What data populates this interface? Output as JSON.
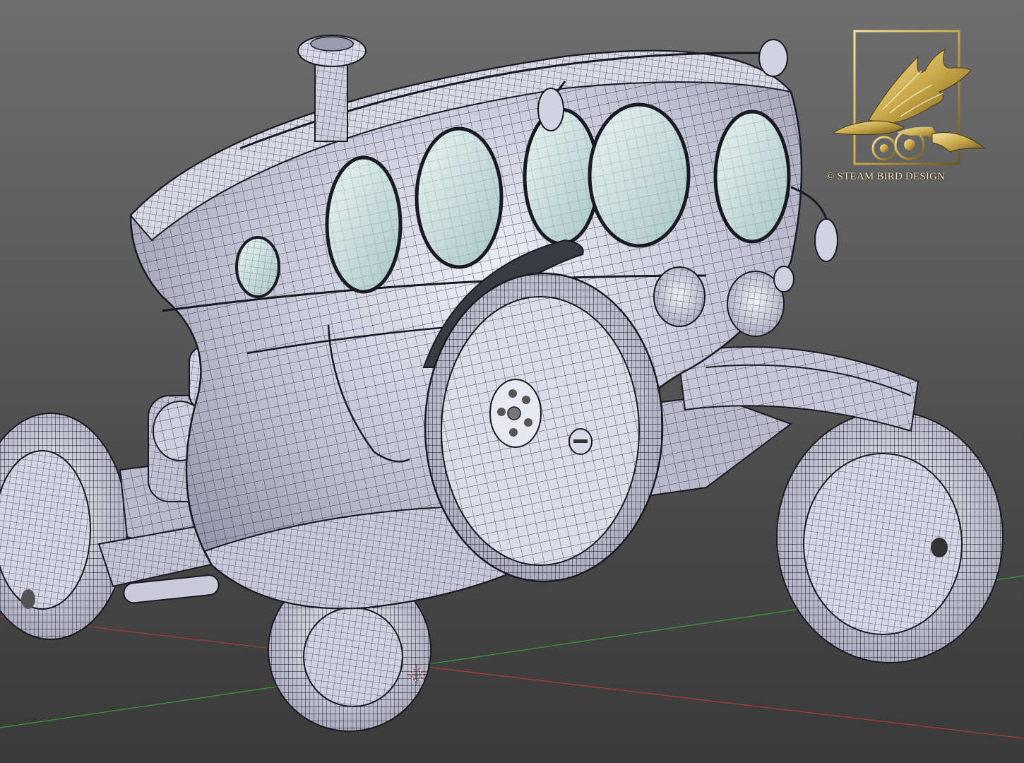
{
  "viewport": {
    "background_top": "#6e6e6e",
    "background_bottom": "#3a3a3a",
    "x_axis_color": "#b03a3a",
    "y_axis_color": "#3c9a3c",
    "wireframe_color": "#1e1e28",
    "surface_color": "#c9c9d8",
    "glass_color": "#cfe3e3"
  },
  "scene": {
    "object": "steampunk-vehicle-wireframe-model",
    "origin_marker": "3d-cursor-icon"
  },
  "watermark": {
    "text": "© STEAM BIRD DESIGN",
    "logo": "steam-bird-logo",
    "gold_color": "#c9a94a"
  }
}
